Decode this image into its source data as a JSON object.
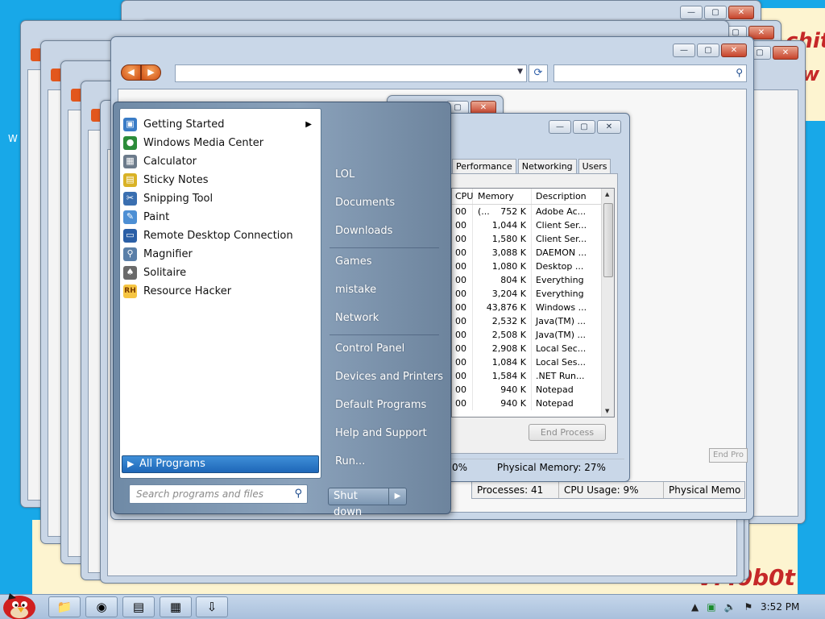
{
  "desktop": {
    "bg_color": "#18a8e8",
    "deco_text_1": "chit",
    "deco_text_2": "w",
    "deco_text_3": "VM0b0t",
    "desktop_letter": "W"
  },
  "start_menu": {
    "programs": [
      {
        "label": "Getting Started",
        "icon": "getting-started-icon",
        "has_submenu": true
      },
      {
        "label": "Windows Media Center",
        "icon": "media-center-icon"
      },
      {
        "label": "Calculator",
        "icon": "calculator-icon"
      },
      {
        "label": "Sticky Notes",
        "icon": "sticky-notes-icon"
      },
      {
        "label": "Snipping Tool",
        "icon": "snipping-tool-icon"
      },
      {
        "label": "Paint",
        "icon": "paint-icon"
      },
      {
        "label": "Remote Desktop Connection",
        "icon": "remote-desktop-icon"
      },
      {
        "label": "Magnifier",
        "icon": "magnifier-icon"
      },
      {
        "label": "Solitaire",
        "icon": "solitaire-icon"
      },
      {
        "label": "Resource Hacker",
        "icon": "resource-hacker-icon",
        "icon_text": "RH"
      }
    ],
    "all_programs": "All Programs",
    "search_placeholder": "Search programs and files",
    "right_items": [
      "LOL",
      "Documents",
      "Downloads",
      "Games",
      "mistake",
      "Network",
      "Control Panel",
      "Devices and Printers",
      "Default Programs",
      "Help and Support",
      "Run..."
    ],
    "shutdown": "Shut down"
  },
  "task_manager": {
    "tabs": [
      "Performance",
      "Networking",
      "Users"
    ],
    "columns": {
      "cpu": "CPU",
      "memory": "Memory (...",
      "description": "Description"
    },
    "rows": [
      {
        "cpu": "00",
        "memory": "752 K",
        "description": "Adobe Ac..."
      },
      {
        "cpu": "00",
        "memory": "1,044 K",
        "description": "Client Ser..."
      },
      {
        "cpu": "00",
        "memory": "1,580 K",
        "description": "Client Ser..."
      },
      {
        "cpu": "00",
        "memory": "3,088 K",
        "description": "DAEMON ..."
      },
      {
        "cpu": "00",
        "memory": "1,080 K",
        "description": "Desktop ..."
      },
      {
        "cpu": "00",
        "memory": "804 K",
        "description": "Everything"
      },
      {
        "cpu": "00",
        "memory": "3,204 K",
        "description": "Everything"
      },
      {
        "cpu": "00",
        "memory": "43,876 K",
        "description": "Windows ..."
      },
      {
        "cpu": "00",
        "memory": "2,532 K",
        "description": "Java(TM) ..."
      },
      {
        "cpu": "00",
        "memory": "2,508 K",
        "description": "Java(TM) ..."
      },
      {
        "cpu": "00",
        "memory": "2,908 K",
        "description": "Local Sec..."
      },
      {
        "cpu": "00",
        "memory": "1,084 K",
        "description": "Local Ses..."
      },
      {
        "cpu": "00",
        "memory": "1,584 K",
        "description": ".NET Run..."
      },
      {
        "cpu": "00",
        "memory": "940 K",
        "description": "Notepad"
      },
      {
        "cpu": "00",
        "memory": "940 K",
        "description": "Notepad"
      }
    ],
    "end_process": "End Process",
    "status_cpu": "0%",
    "status_memory": "Physical Memory: 27%"
  },
  "task_manager_2": {
    "processes": "Processes: 41",
    "cpu_usage": "CPU Usage: 9%",
    "physical_memory": "Physical Memo",
    "end_process": "End Pro"
  },
  "taskbar": {
    "buttons": [
      "explorer-icon",
      "chrome-icon",
      "notepad-icon",
      "task-manager-icon",
      "resource-hacker-icon"
    ],
    "clock": "3:52 PM"
  }
}
